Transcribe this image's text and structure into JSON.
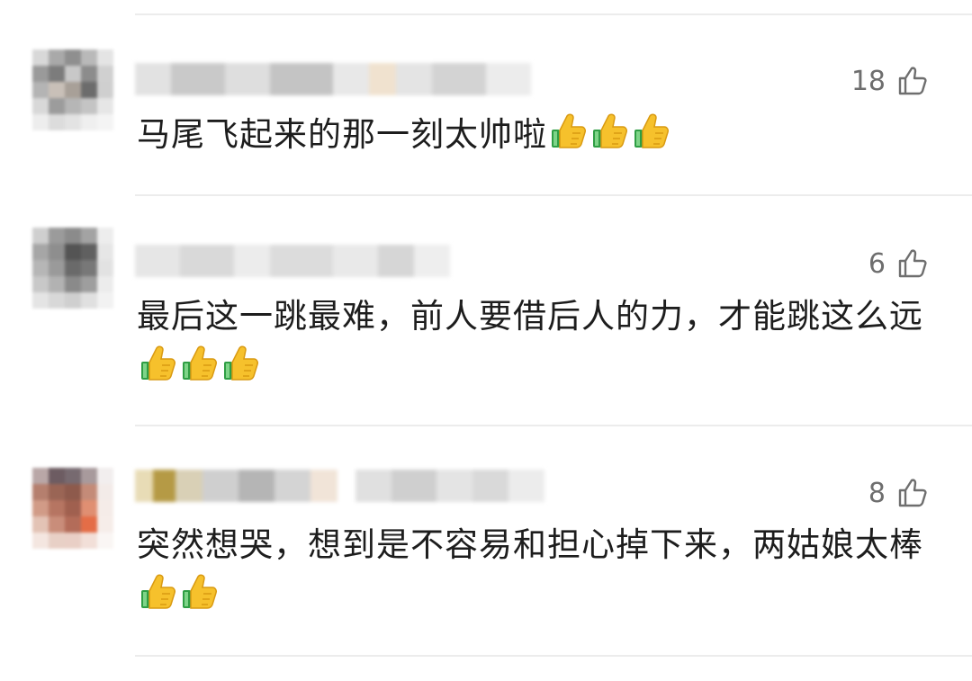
{
  "comments": [
    {
      "likes": "18",
      "text": "马尾飞起来的那一刻太帅啦",
      "emoji_count": 3,
      "emoji_icon": "thumbs-up-icon"
    },
    {
      "likes": "6",
      "text": "最后这一跳最难，前人要借后人的力，才能跳这么远",
      "emoji_count": 3,
      "emoji_icon": "thumbs-up-icon"
    },
    {
      "likes": "8",
      "text": "突然想哭，想到是不容易和担心掉下来，两姑娘太棒",
      "emoji_count": 2,
      "emoji_icon": "thumbs-up-icon"
    }
  ],
  "like_icon": "thumbs-up-outline-icon",
  "colors": {
    "like_count": "#6e6e6e",
    "divider": "#ececec",
    "text": "#1d1d1d"
  }
}
